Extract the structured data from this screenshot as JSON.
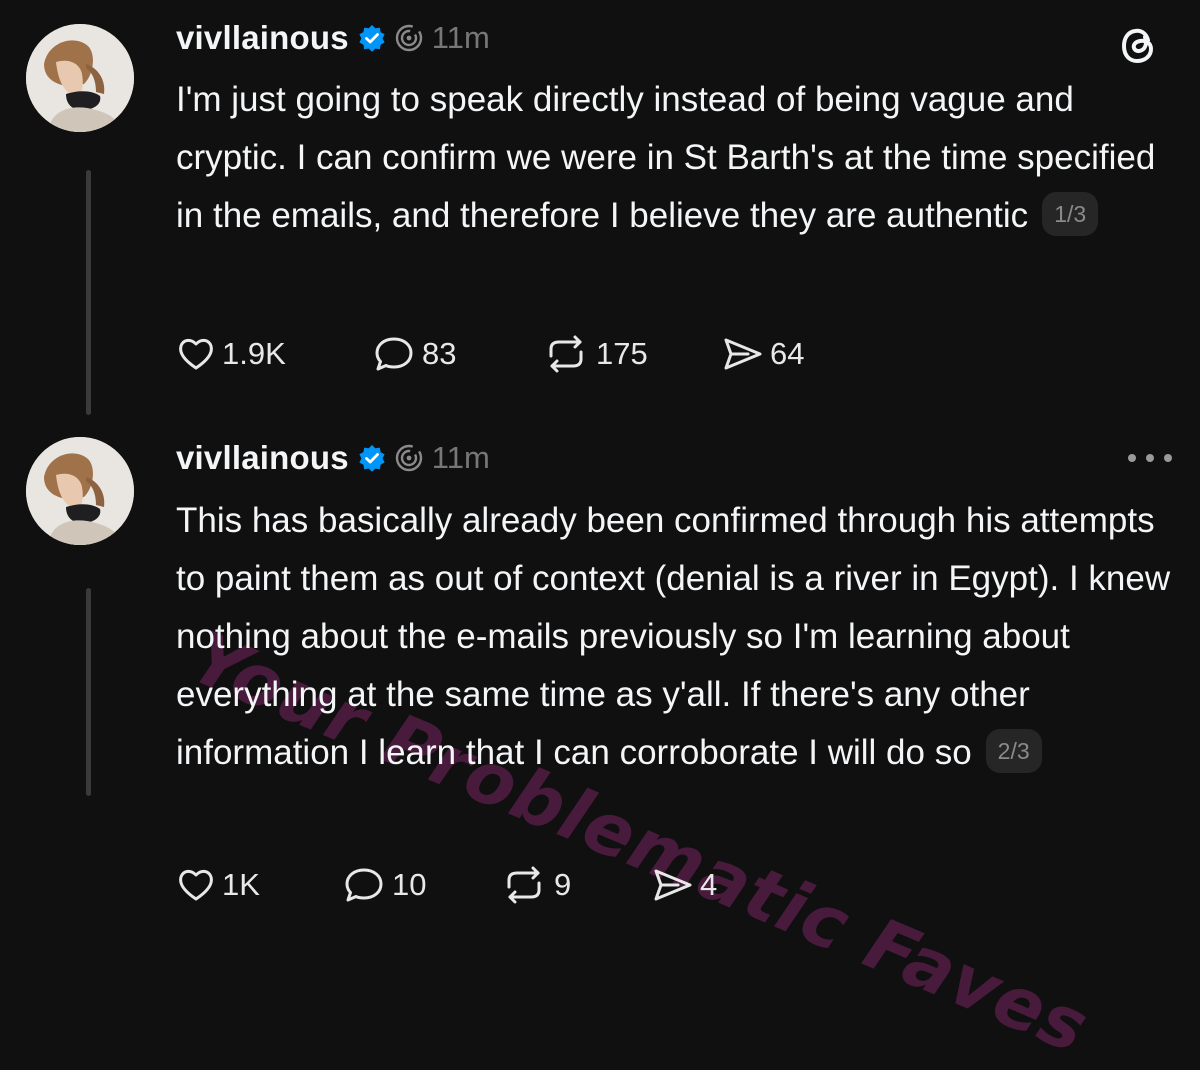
{
  "posts": [
    {
      "username": "vivllainous",
      "time": "11m",
      "text": "I'm just going to speak directly instead of being vague and cryptic. I can confirm we were in St Barth's at the time specified in the emails, and therefore I believe they are authentic",
      "pager": "1/3",
      "likes": "1.9K",
      "replies": "83",
      "reposts": "175",
      "shares": "64"
    },
    {
      "username": "vivllainous",
      "time": "11m",
      "text": "This has basically already been confirmed through his attempts to paint them as out of context (denial is a river in Egypt). I knew nothing about the e-mails previously so I'm learning about everything at the same time as y'all. If there's any other information I learn that I can corroborate I will do so",
      "pager": "2/3",
      "likes": "1K",
      "replies": "10",
      "reposts": "9",
      "shares": "4"
    }
  ],
  "watermark": "Your Problematic Faves",
  "icons": {
    "verified": "verified-badge-icon",
    "thread": "thread-spiral-icon",
    "logo": "threads-logo-icon",
    "like": "heart-icon",
    "reply": "comment-icon",
    "repost": "repost-icon",
    "share": "send-icon",
    "more": "more-dots-icon"
  },
  "colors": {
    "background": "#101010",
    "text": "#f3f5f7",
    "muted": "#777777",
    "verified": "#0095f6",
    "watermark": "#962878"
  }
}
